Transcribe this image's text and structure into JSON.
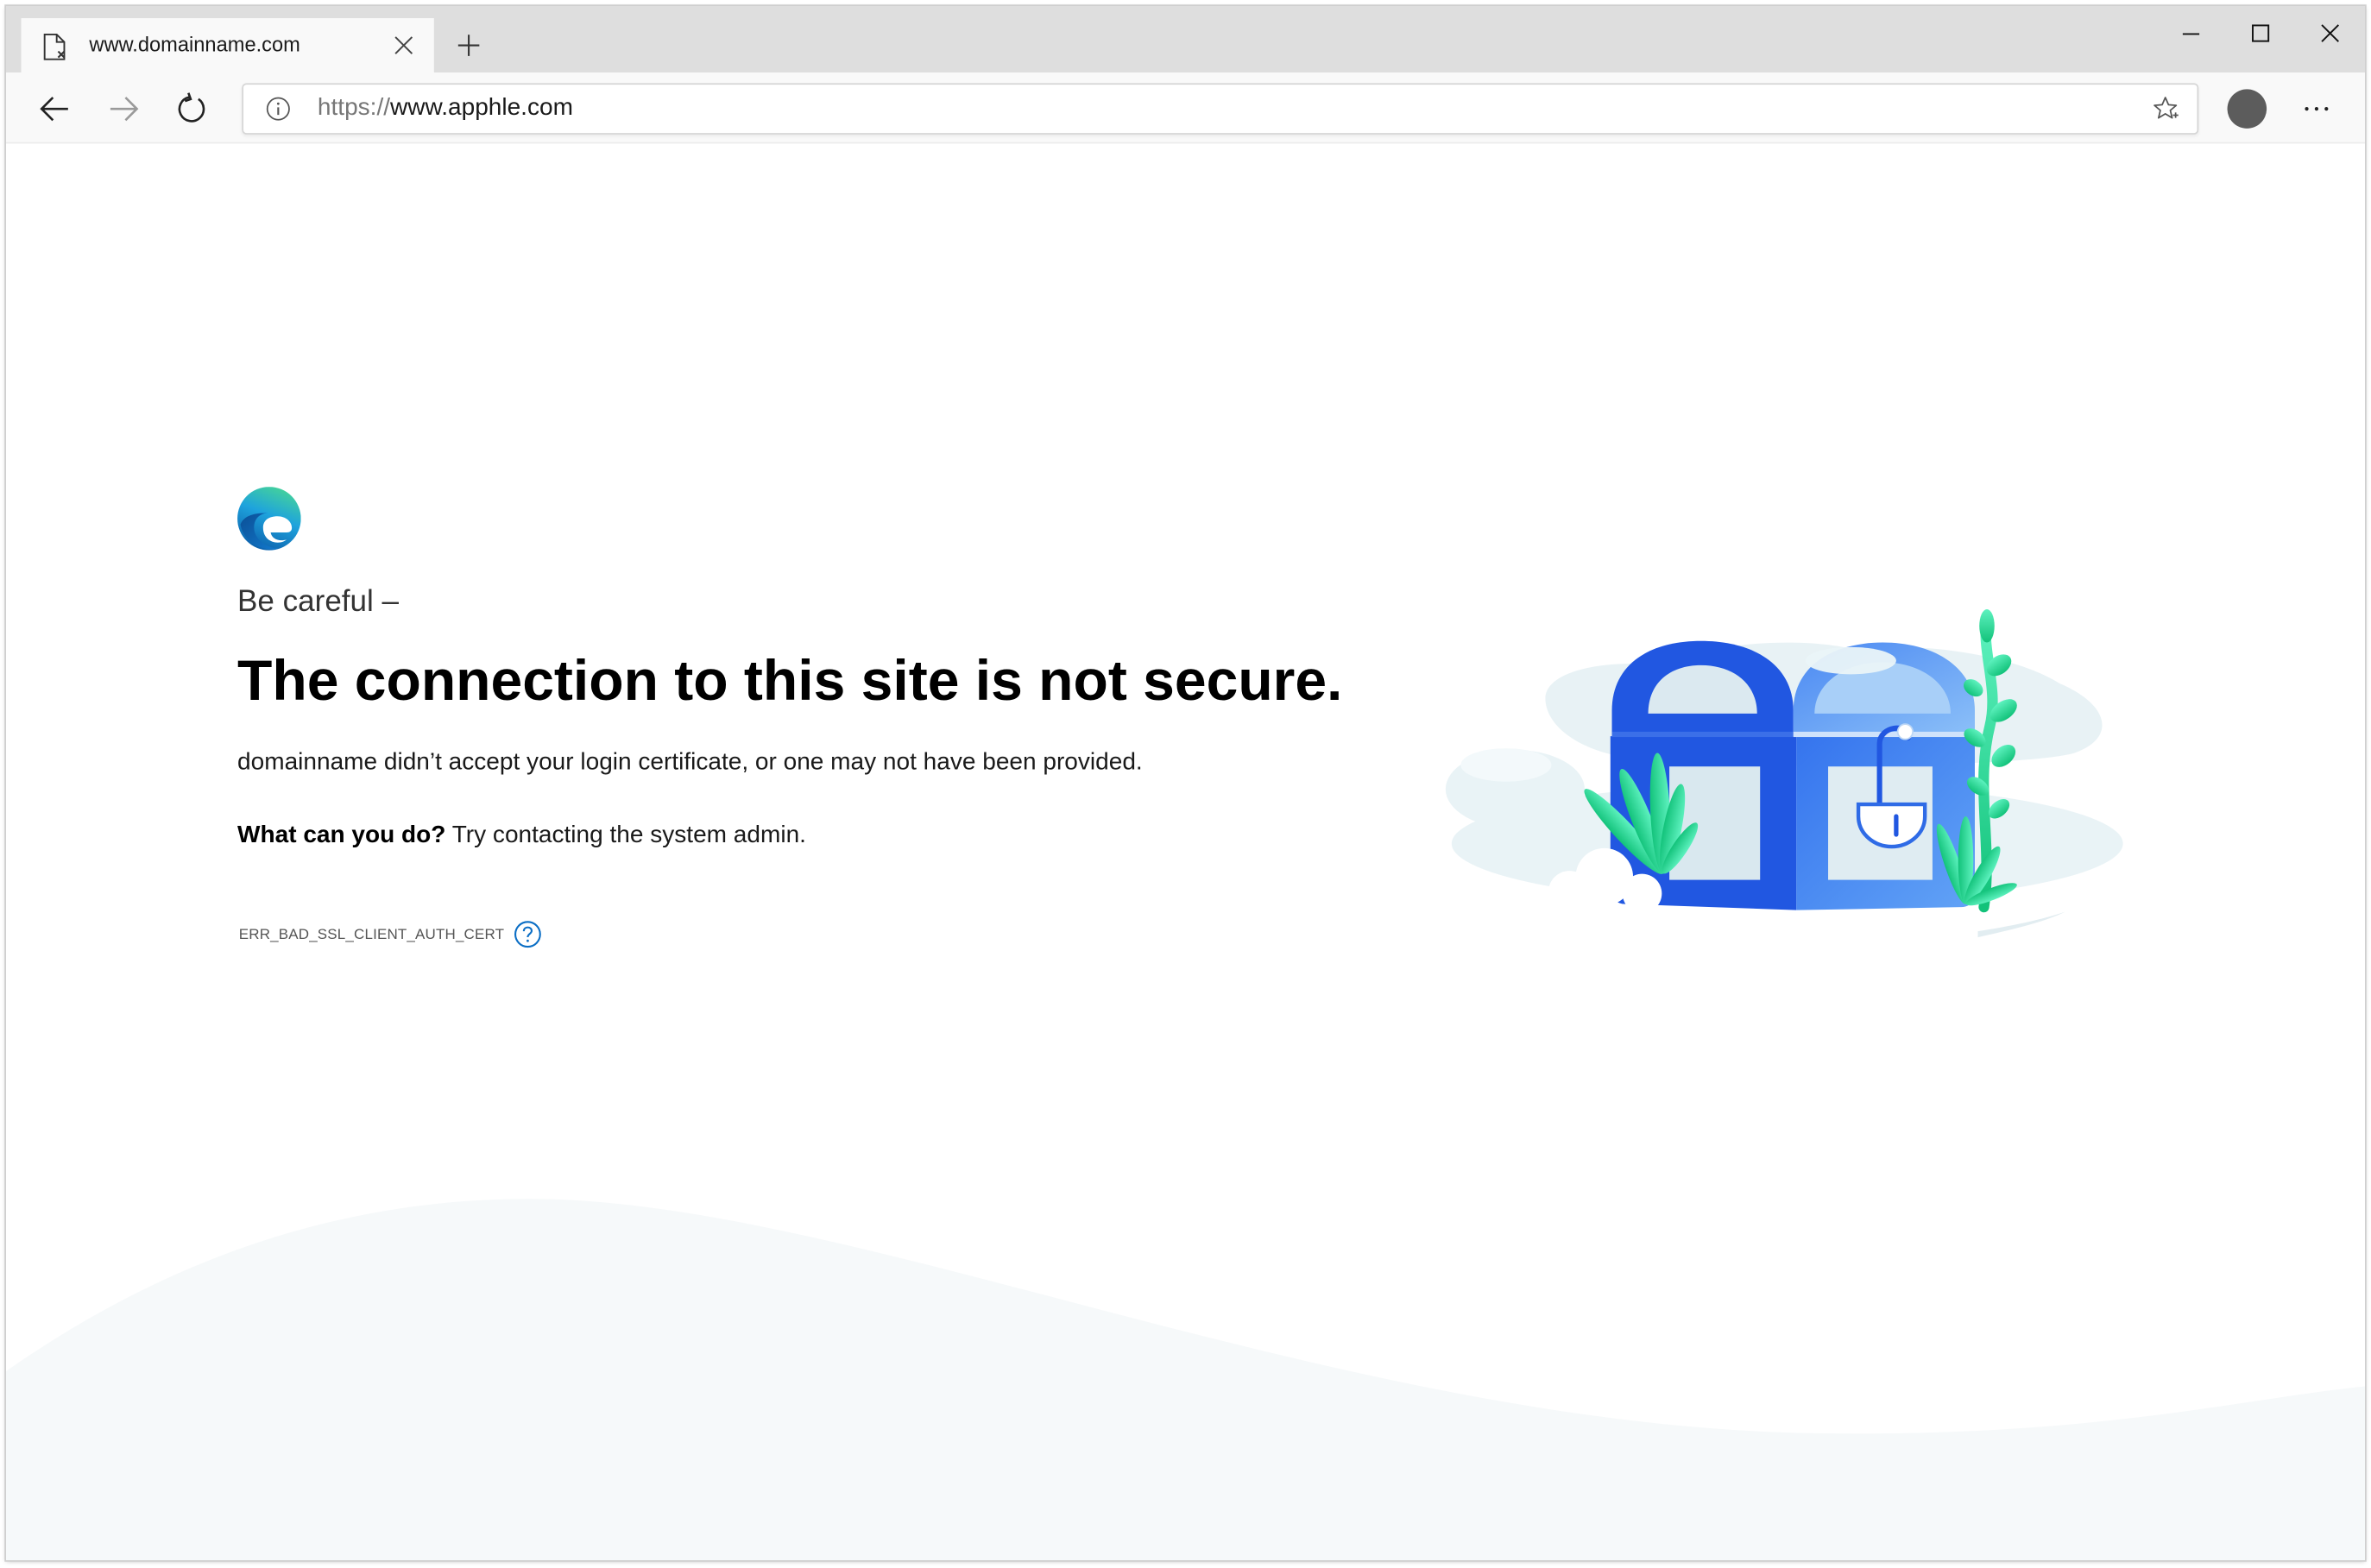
{
  "browser": {
    "tab": {
      "title": "www.domainname.com",
      "icon": "page-error-icon",
      "close_icon": "close-icon"
    },
    "new_tab_icon": "plus-icon",
    "window_controls": {
      "minimize_icon": "minimize-icon",
      "maximize_icon": "maximize-icon",
      "close_icon": "close-icon"
    },
    "nav": {
      "back_icon": "back-arrow-icon",
      "forward_icon": "forward-arrow-icon",
      "refresh_icon": "refresh-icon"
    },
    "address_bar": {
      "info_icon": "info-icon",
      "scheme": "https://",
      "host": "www.apphle.com",
      "favorite_icon": "star-icon"
    },
    "profile_icon": "avatar-icon",
    "menu_icon": "more-icon"
  },
  "page": {
    "logo_icon": "edge-logo-icon",
    "eyebrow": "Be careful –",
    "heading": "The connection to this site is not secure.",
    "description": "domainname didn’t accept your login certificate, or one may not have been provided.",
    "action_label": "What can you do?",
    "action_text": "Try contacting the system admin.",
    "error_code": "ERR_BAD_SSL_CLIENT_AUTH_CERT",
    "help_icon": "help-icon",
    "illustration": "locked-chest-illustration"
  },
  "colors": {
    "title_bar": "#dedede",
    "toolbar": "#f9f9f9",
    "help_accent": "#0b6ec5",
    "chest_blue": "#2157e1",
    "plant_green": "#22d48c",
    "wave": "#f6f9fa"
  }
}
